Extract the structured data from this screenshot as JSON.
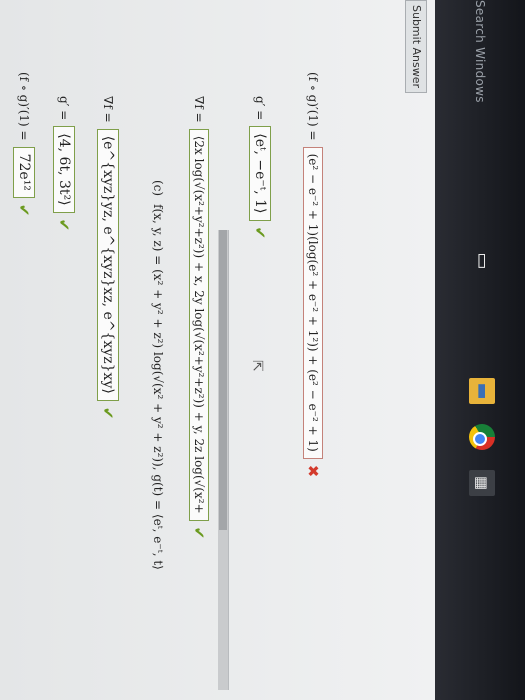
{
  "taskbar": {
    "search_text": "Search Windows",
    "icons": [
      "task-view-icon",
      "file-explorer-icon",
      "chrome-icon",
      "calculator-icon"
    ]
  },
  "part_b": {
    "grad_label": "∇f =",
    "grad_answer": "⟨e^{xyz}yz, e^{xyz}xz, e^{xyz}xy⟩",
    "g_prime_label": "g′ =",
    "g_prime_answer": "⟨4, 6t, 3t²⟩",
    "composite_label": "(f ∘ g)′(1) =",
    "composite_answer": "72e¹²"
  },
  "part_c": {
    "tag": "(c)",
    "problem": "f(x, y, z) = (x² + y² + z²) log(√(x² + y² + z²)),  g(t) = ⟨eᵗ, e⁻ᵗ, t⟩",
    "grad_label": "∇f =",
    "grad_answer": "⟨2x log(√(x²+y²+z²)) + x, 2y log(√(x²+y²+z²)) + y, 2z log(√(x²+",
    "g_prime_label": "g′ =",
    "g_prime_answer": "⟨eᵗ, −e⁻ᵗ, 1⟩",
    "composite_label": "(f ∘ g)′(1) =",
    "composite_answer": "(e² − e⁻² + 1)(log(e² + e⁻² + 1²)) + (e² − e⁻² + 1)"
  },
  "submit_label": "Submit Answer",
  "status": {
    "correct_symbol": "✔",
    "incorrect_symbol": "✖"
  },
  "colors": {
    "correct": "#6b9a1f",
    "incorrect": "#d33a2c"
  }
}
